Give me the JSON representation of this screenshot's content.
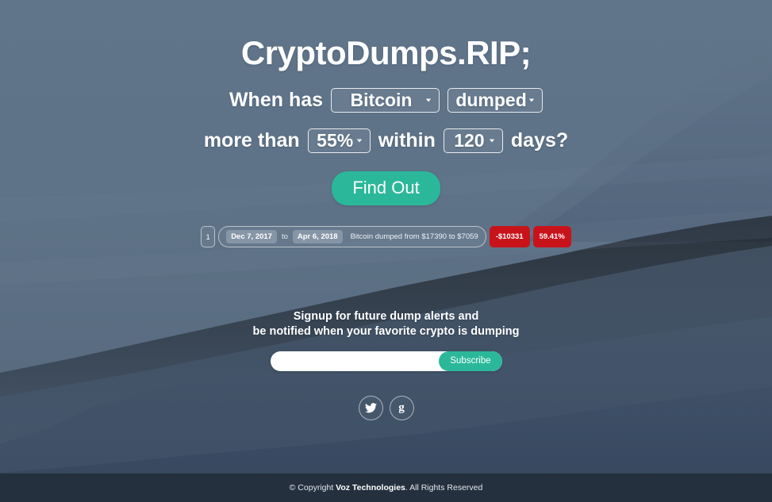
{
  "site": {
    "title": "CryptoDumps.RIP;"
  },
  "query": {
    "line1_prefix": "When has",
    "coin_value": "Bitcoin",
    "action_value": "dumped",
    "line2_prefix": "more than",
    "percent_value": "55%",
    "middle_word": "within",
    "days_value": "120",
    "line2_suffix": "days?",
    "submit_label": "Find Out"
  },
  "results": [
    {
      "index": "1",
      "start_date": "Dec 7, 2017",
      "to_label": "to",
      "end_date": "Apr 6, 2018",
      "description": "Bitcoin dumped from $17390 to $7059",
      "amount_badge": "-$10331",
      "percent_badge": "59.41%"
    }
  ],
  "signup": {
    "headline_line1": "Signup for future dump alerts and",
    "headline_line2": "be notified when your favorite crypto is dumping",
    "email_value": "",
    "email_placeholder": "",
    "subscribe_label": "Subscribe"
  },
  "social": {
    "twitter_name": "twitter-icon",
    "gplus_glyph": "g"
  },
  "footer": {
    "copyright_prefix": "© Copyright ",
    "company": "Voz Technologies",
    "copyright_suffix": ". All Rights Reserved"
  },
  "colors": {
    "accent_teal": "#2bb89a",
    "badge_red": "#c9131b",
    "sky": "#5f7389",
    "footer": "#25303e"
  }
}
